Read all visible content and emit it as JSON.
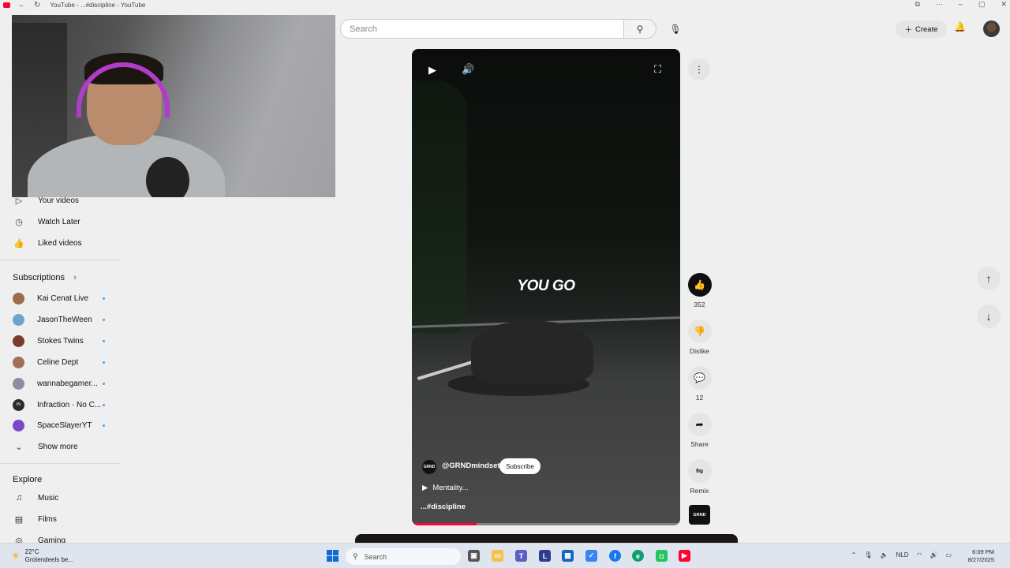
{
  "browser": {
    "tab_title": "YouTube - ...#discipline - YouTube",
    "controls": [
      "⧉",
      "⋯",
      "–",
      "▢",
      "✕"
    ]
  },
  "search": {
    "placeholder": "Search"
  },
  "masthead": {
    "create_label": "Create"
  },
  "sidebar": {
    "you_items": [
      {
        "label": "Your videos",
        "icon": "play-square-icon"
      },
      {
        "label": "Watch Later",
        "icon": "clock-icon"
      },
      {
        "label": "Liked videos",
        "icon": "thumb-up-icon"
      }
    ],
    "subscriptions_title": "Subscriptions",
    "subscriptions": [
      {
        "label": "Kai Cenat Live",
        "color": "#9b6b4b"
      },
      {
        "label": "JasonTheWeen",
        "color": "#6aa5c9"
      },
      {
        "label": "Stokes Twins",
        "color": "#7a3b2e"
      },
      {
        "label": "Celine Dept",
        "color": "#a0705a"
      },
      {
        "label": "wannabegamer...",
        "color": "#8a8ea3"
      },
      {
        "label": "Infraction · No C...",
        "color": "#2a2a2a",
        "avatar_text": "IN"
      },
      {
        "label": "SpaceSlayerYT",
        "color": "#7a48c9"
      }
    ],
    "show_more": "Show more",
    "explore_title": "Explore",
    "explore": [
      {
        "label": "Music",
        "icon": "music-icon"
      },
      {
        "label": "Films",
        "icon": "film-icon"
      },
      {
        "label": "Gaming",
        "icon": "gaming-icon"
      }
    ]
  },
  "short": {
    "overlay_text": "YOU GO",
    "channel_logo": "GRND",
    "channel": "@GRNDmindset",
    "subscribe": "Subscribe",
    "sound": "Mentality...",
    "hashtag": "...#discipline",
    "progress": 0.24
  },
  "actions": {
    "like_count": "352",
    "dislike": "Dislike",
    "comments": "12",
    "share": "Share",
    "remix": "Remix",
    "grnd": "GRND"
  },
  "taskbar": {
    "temp": "22°C",
    "weather": "Grotendeels be...",
    "search": "Search",
    "lang": "NLD",
    "time": "6:09 PM",
    "date": "8/27/2025"
  },
  "colors": {
    "accent": "#ff0033",
    "dark": "#0f0f0f"
  }
}
